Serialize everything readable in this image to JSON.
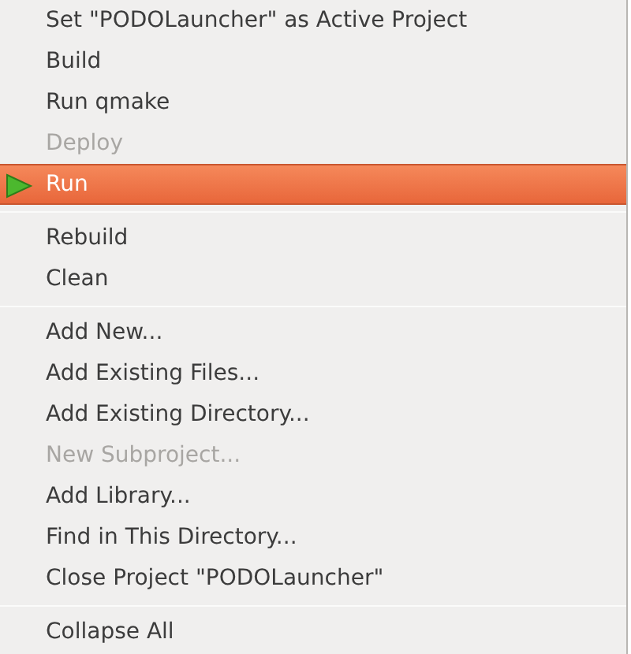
{
  "menu": {
    "sections": [
      {
        "items": [
          {
            "label": "Set \"PODOLauncher\" as Active Project",
            "kind": "plain",
            "disabled": false,
            "selected": false
          },
          {
            "label": "Build",
            "kind": "plain",
            "disabled": false,
            "selected": false
          },
          {
            "label": "Run qmake",
            "kind": "plain",
            "disabled": false,
            "selected": false
          },
          {
            "label": "Deploy",
            "kind": "plain",
            "disabled": true,
            "selected": false
          },
          {
            "label": "Run",
            "kind": "play",
            "disabled": false,
            "selected": true
          }
        ]
      },
      {
        "items": [
          {
            "label": "Rebuild",
            "kind": "plain",
            "disabled": false,
            "selected": false
          },
          {
            "label": "Clean",
            "kind": "plain",
            "disabled": false,
            "selected": false
          }
        ]
      },
      {
        "items": [
          {
            "label": "Add New...",
            "kind": "plain",
            "disabled": false,
            "selected": false
          },
          {
            "label": "Add Existing Files...",
            "kind": "plain",
            "disabled": false,
            "selected": false
          },
          {
            "label": "Add Existing Directory...",
            "kind": "plain",
            "disabled": false,
            "selected": false
          },
          {
            "label": "New Subproject...",
            "kind": "plain",
            "disabled": true,
            "selected": false
          },
          {
            "label": "Add Library...",
            "kind": "plain",
            "disabled": false,
            "selected": false
          },
          {
            "label": "Find in This Directory...",
            "kind": "plain",
            "disabled": false,
            "selected": false
          },
          {
            "label": "Close Project \"PODOLauncher\"",
            "kind": "plain",
            "disabled": false,
            "selected": false
          }
        ]
      },
      {
        "items": [
          {
            "label": "Collapse All",
            "kind": "plain",
            "disabled": false,
            "selected": false
          }
        ]
      }
    ]
  }
}
